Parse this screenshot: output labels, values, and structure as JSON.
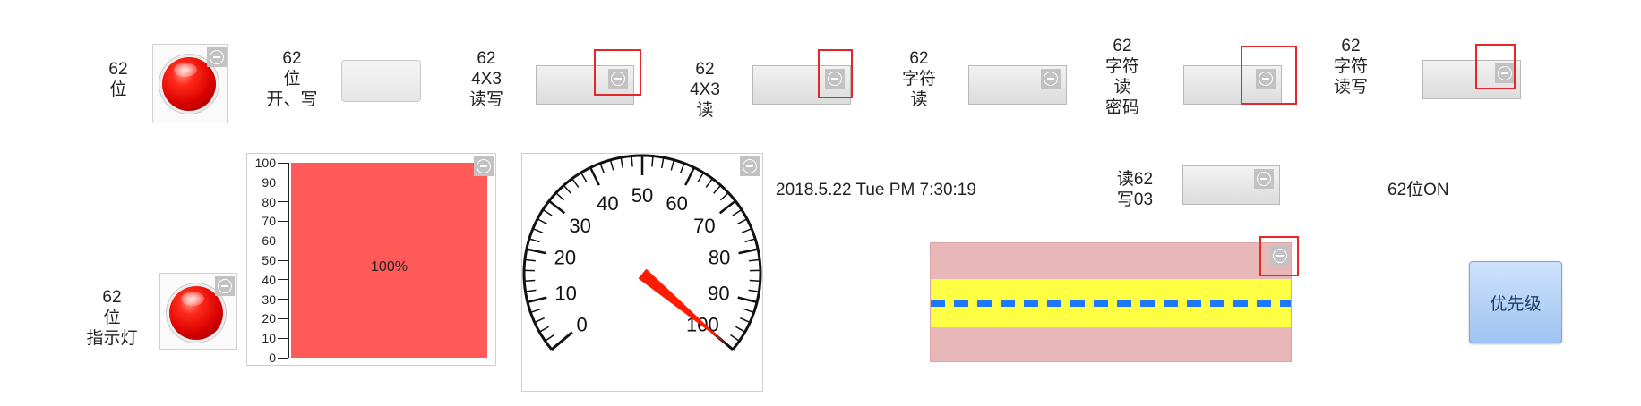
{
  "labels": {
    "l1": [
      "62",
      "位"
    ],
    "l2": [
      "62",
      "位",
      "开、写"
    ],
    "l3": [
      "62",
      "4X3",
      "读写"
    ],
    "l4": [
      "62",
      "4X3",
      "读"
    ],
    "l5": [
      "62",
      "字符",
      "读"
    ],
    "l6": [
      "62",
      "字符",
      "读",
      "密码"
    ],
    "l7": [
      "62",
      "字符",
      "读写"
    ],
    "l8": [
      "62",
      "位",
      "指示灯"
    ],
    "l9": [
      "读62",
      "写03"
    ]
  },
  "datetime": "2018.5.22 Tue PM 7:30:19",
  "status_text": "62位ON",
  "priority_button": "优先级",
  "bar_gauge": {
    "value_label": "100%",
    "ticks": [
      "100",
      "90",
      "80",
      "70",
      "60",
      "50",
      "40",
      "30",
      "20",
      "10",
      "0"
    ],
    "fill_color": "#ff5a57",
    "value_fraction": 1.0
  },
  "dial": {
    "tick_labels": [
      "0",
      "10",
      "20",
      "30",
      "40",
      "50",
      "60",
      "70",
      "80",
      "90",
      "100"
    ],
    "value": 100,
    "min": 0,
    "max": 100,
    "needle_color": "#ff1a00"
  },
  "pipe": {
    "outer_color": "#e8b8b8",
    "inner_color": "#ffff44",
    "flow_color": "#1e78ff"
  },
  "icons": {
    "control": "minus-circle-icon",
    "lamp": "red-indicator-lamp-icon"
  }
}
